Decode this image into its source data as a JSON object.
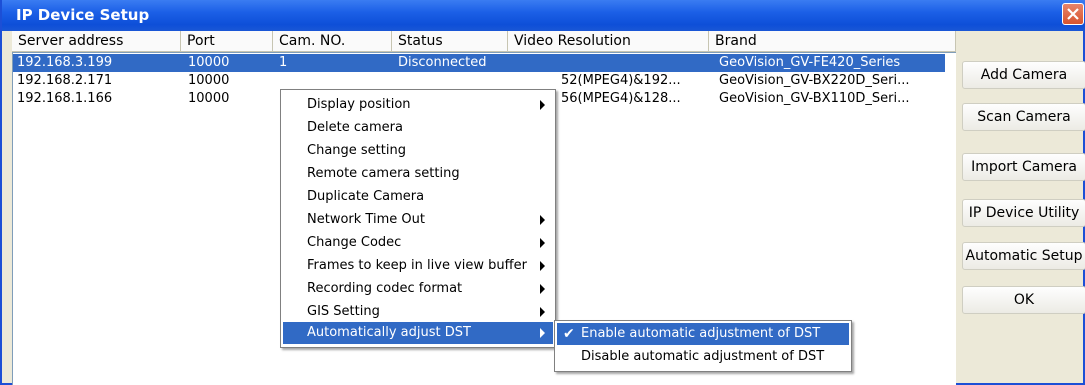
{
  "window": {
    "title": "IP Device Setup",
    "accent": "#316ac5",
    "title_bar": "#0e4fd8"
  },
  "columns": [
    "Server address",
    "Port",
    "Cam. NO.",
    "Status",
    "Video Resolution",
    "Brand"
  ],
  "rows": [
    {
      "server": "192.168.3.199",
      "port": "10000",
      "cam": "1",
      "status": "Disconnected",
      "resolution": "",
      "brand": "GeoVision_GV-FE420_Series",
      "selected": true
    },
    {
      "server": "192.168.2.171",
      "port": "10000",
      "cam": "",
      "status": "",
      "resolution": "52(MPEG4)&192...",
      "brand": "GeoVision_GV-BX220D_Seri...",
      "selected": false
    },
    {
      "server": "192.168.1.166",
      "port": "10000",
      "cam": "",
      "status": "",
      "resolution": "56(MPEG4)&128...",
      "brand": "GeoVision_GV-BX110D_Seri...",
      "selected": false
    }
  ],
  "buttons": [
    "Add Camera",
    "Scan Camera",
    "Import Camera",
    "IP Device Utility",
    "Automatic Setup",
    "OK"
  ],
  "context_menu": [
    {
      "label": "Display position",
      "submenu": true
    },
    {
      "label": "Delete camera",
      "submenu": false
    },
    {
      "label": "Change setting",
      "submenu": false
    },
    {
      "label": "Remote camera setting",
      "submenu": false
    },
    {
      "label": "Duplicate Camera",
      "submenu": false
    },
    {
      "label": "Network Time Out",
      "submenu": true
    },
    {
      "label": "Change Codec",
      "submenu": true
    },
    {
      "label": "Frames to keep in live view buffer",
      "submenu": true
    },
    {
      "label": "Recording codec format",
      "submenu": true
    },
    {
      "label": "GIS Setting",
      "submenu": true
    },
    {
      "label": "Automatically adjust DST",
      "submenu": true,
      "highlighted": true
    }
  ],
  "submenu": [
    {
      "label": "Enable automatic adjustment of DST",
      "checked": true,
      "highlighted": true
    },
    {
      "label": "Disable automatic adjustment of DST",
      "checked": false,
      "highlighted": false
    }
  ]
}
